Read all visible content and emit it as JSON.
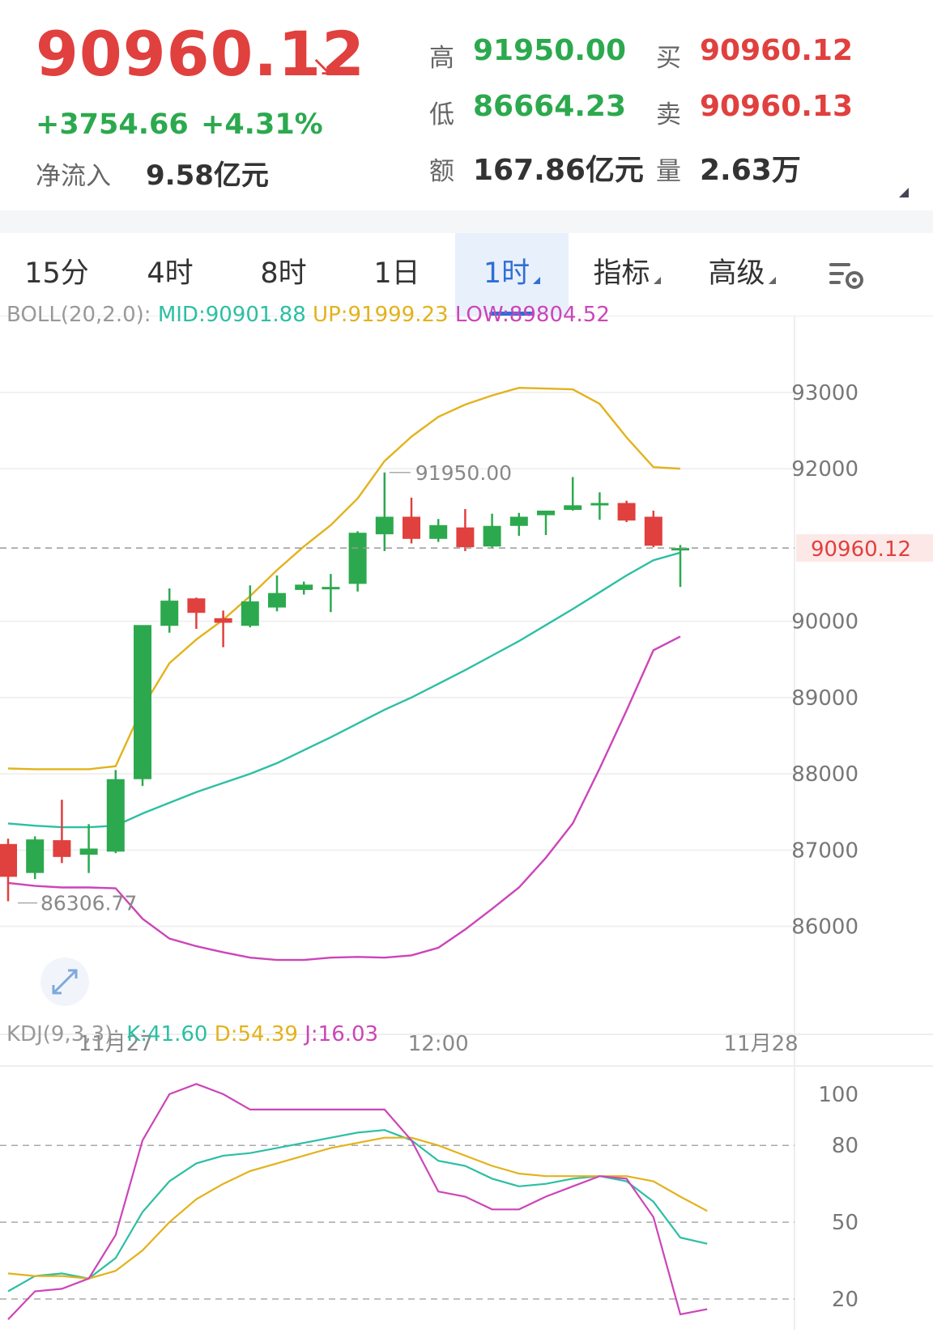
{
  "quote": {
    "price": "90960.12",
    "change": "+3754.66",
    "change_pct": "+4.31%",
    "net_inflow_label": "净流入",
    "net_inflow_value": "9.58亿元",
    "high_label": "高",
    "high_value": "91950.00",
    "low_label": "低",
    "low_value": "86664.23",
    "amount_label": "额",
    "amount_value": "167.86亿元",
    "bid_label": "买",
    "bid_value": "90960.12",
    "ask_label": "卖",
    "ask_value": "90960.13",
    "volume_label": "量",
    "volume_value": "2.63万",
    "colors": {
      "up": "#e0403e",
      "down": "#2ca94e"
    }
  },
  "tabs": [
    {
      "label": "15分",
      "active": false,
      "dropdown": false
    },
    {
      "label": "4时",
      "active": false,
      "dropdown": false
    },
    {
      "label": "8时",
      "active": false,
      "dropdown": false
    },
    {
      "label": "1日",
      "active": false,
      "dropdown": false
    },
    {
      "label": "1时",
      "active": true,
      "dropdown": true
    },
    {
      "label": "指标",
      "active": false,
      "dropdown": true
    },
    {
      "label": "高级",
      "active": false,
      "dropdown": true
    }
  ],
  "settings_icon": "chart-settings-icon",
  "chart_data": [
    {
      "type": "candlestick",
      "legend_prefix": "BOLL(20,2.0):",
      "legend": [
        {
          "text": "MID:90901.88",
          "color": "#2cbfa4"
        },
        {
          "text": "UP:91999.23",
          "color": "#e3b21c"
        },
        {
          "text": "LOW:89804.52",
          "color": "#cc45b8"
        }
      ],
      "yticks": [
        93000,
        92000,
        90000,
        89000,
        88000,
        87000,
        86000
      ],
      "ylim": [
        85200,
        93900
      ],
      "current_price_label": "90960.12",
      "current_price": 90960.12,
      "max_label": "91950.00",
      "min_label": "86306.77",
      "xticks": [
        {
          "label": "11月27",
          "index": 4
        },
        {
          "label": "12:00",
          "index": 16
        },
        {
          "label": "11月28",
          "index": 28
        }
      ],
      "candles": [
        {
          "o": 87080,
          "h": 87150,
          "c": 86650,
          "l": 86330
        },
        {
          "o": 86700,
          "h": 87180,
          "c": 87140,
          "l": 86620
        },
        {
          "o": 87130,
          "h": 87660,
          "c": 86910,
          "l": 86830
        },
        {
          "o": 86940,
          "h": 87340,
          "c": 87020,
          "l": 86700
        },
        {
          "o": 86980,
          "h": 88050,
          "c": 87930,
          "l": 86960
        },
        {
          "o": 87930,
          "h": 89920,
          "c": 89950,
          "l": 87840
        },
        {
          "o": 89940,
          "h": 90430,
          "c": 90270,
          "l": 89850
        },
        {
          "o": 90300,
          "h": 90310,
          "c": 90110,
          "l": 89900
        },
        {
          "o": 90040,
          "h": 90140,
          "c": 89980,
          "l": 89660
        },
        {
          "o": 89940,
          "h": 90470,
          "c": 90260,
          "l": 89920
        },
        {
          "o": 90180,
          "h": 90600,
          "c": 90370,
          "l": 90130
        },
        {
          "o": 90410,
          "h": 90520,
          "c": 90480,
          "l": 90350
        },
        {
          "o": 90440,
          "h": 90620,
          "c": 90450,
          "l": 90120
        },
        {
          "o": 90490,
          "h": 91180,
          "c": 91160,
          "l": 90390
        },
        {
          "o": 91140,
          "h": 91950,
          "c": 91370,
          "l": 90920
        },
        {
          "o": 91370,
          "h": 91620,
          "c": 91080,
          "l": 91020
        },
        {
          "o": 91080,
          "h": 91340,
          "c": 91260,
          "l": 91040
        },
        {
          "o": 91230,
          "h": 91470,
          "c": 90970,
          "l": 90920
        },
        {
          "o": 90980,
          "h": 91410,
          "c": 91250,
          "l": 90960
        },
        {
          "o": 91250,
          "h": 91420,
          "c": 91370,
          "l": 91120
        },
        {
          "o": 91390,
          "h": 91450,
          "c": 91450,
          "l": 91130
        },
        {
          "o": 91460,
          "h": 91890,
          "c": 91520,
          "l": 91450
        },
        {
          "o": 91530,
          "h": 91690,
          "c": 91550,
          "l": 91330
        },
        {
          "o": 91550,
          "h": 91580,
          "c": 91320,
          "l": 91300
        },
        {
          "o": 91370,
          "h": 91450,
          "c": 90990,
          "l": 90970
        },
        {
          "o": 90960,
          "h": 91000,
          "c": 90960,
          "l": 90450
        }
      ],
      "series": [
        {
          "key": "up",
          "color": "#e3b21c",
          "values": [
            88070,
            88060,
            88060,
            88060,
            88100,
            88870,
            89450,
            89760,
            90020,
            90330,
            90670,
            90980,
            91260,
            91610,
            92100,
            92420,
            92680,
            92840,
            92960,
            93060,
            93050,
            93040,
            92850,
            92410,
            92020,
            92000
          ]
        },
        {
          "key": "mid",
          "color": "#2cbfa4",
          "values": [
            87350,
            87320,
            87300,
            87300,
            87320,
            87480,
            87620,
            87760,
            87880,
            88000,
            88140,
            88310,
            88480,
            88660,
            88840,
            89000,
            89180,
            89360,
            89550,
            89740,
            89950,
            90160,
            90380,
            90600,
            90800,
            90900
          ]
        },
        {
          "key": "low",
          "color": "#cc45b8",
          "values": [
            86570,
            86530,
            86510,
            86510,
            86500,
            86100,
            85840,
            85740,
            85660,
            85590,
            85560,
            85560,
            85590,
            85600,
            85590,
            85620,
            85720,
            85960,
            86230,
            86510,
            86900,
            87350,
            88070,
            88830,
            89620,
            89800
          ]
        }
      ]
    },
    {
      "type": "line",
      "legend_prefix": "KDJ(9,3,3):",
      "legend": [
        {
          "text": "K:41.60",
          "color": "#2cbfa4"
        },
        {
          "text": "D:54.39",
          "color": "#e3b21c"
        },
        {
          "text": "J:16.03",
          "color": "#cc45b8"
        }
      ],
      "yticks": [
        100,
        80,
        50,
        20
      ],
      "ylim": [
        8,
        118
      ],
      "series": [
        {
          "key": "K",
          "color": "#2cbfa4",
          "values": [
            23,
            29,
            30,
            28,
            36,
            54,
            66,
            73,
            76,
            77,
            79,
            81,
            83,
            85,
            86,
            82,
            74,
            72,
            67,
            64,
            65,
            67,
            68,
            66,
            58,
            44,
            41.6
          ]
        },
        {
          "key": "D",
          "color": "#e3b21c",
          "values": [
            30,
            29,
            29,
            28,
            31,
            39,
            50,
            59,
            65,
            70,
            73,
            76,
            79,
            81,
            83,
            83,
            80,
            76,
            72,
            69,
            68,
            68,
            68,
            68,
            66,
            60,
            54.39
          ]
        },
        {
          "key": "J",
          "color": "#cc45b8",
          "values": [
            12,
            23,
            24,
            28,
            45,
            82,
            100,
            104,
            100,
            94,
            94,
            94,
            94,
            94,
            94,
            82,
            62,
            60,
            55,
            55,
            60,
            64,
            68,
            67,
            52,
            14,
            16.03
          ]
        }
      ]
    }
  ]
}
